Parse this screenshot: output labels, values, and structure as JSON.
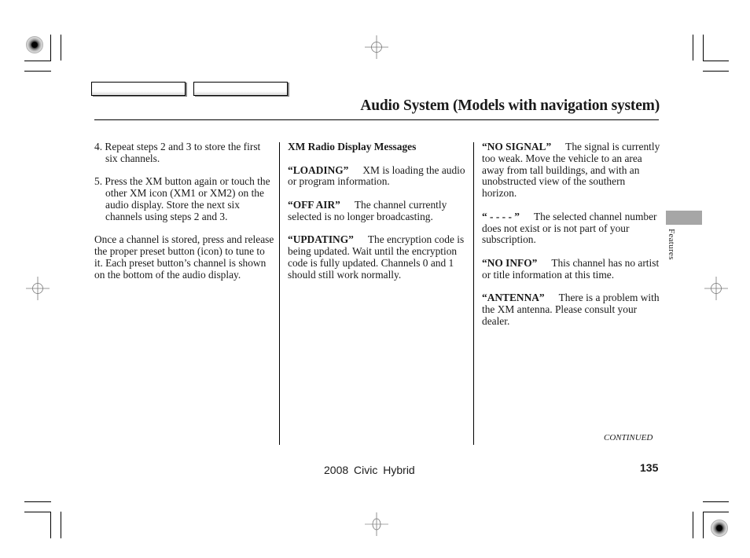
{
  "header": {
    "title": "Audio System (Models with navigation system)"
  },
  "columns": {
    "left": {
      "steps": [
        {
          "number": "4.",
          "text": "Repeat steps 2 and 3 to store the first six channels."
        },
        {
          "number": "5.",
          "text": "Press the XM button again or touch the other XM icon (XM1 or XM2) on the audio display. Store the next six channels using steps 2 and 3."
        }
      ],
      "paragraph": "Once a channel is stored, press and release the proper preset button (icon) to tune to it. Each preset button’s channel is shown on the bottom of the audio display."
    },
    "middle": {
      "heading": "XM Radio Display Messages",
      "messages": [
        {
          "term": "“LOADING”",
          "text": "XM is loading the audio or program information."
        },
        {
          "term": "“OFF AIR”",
          "text": "The channel currently selected is no longer broadcasting."
        },
        {
          "term": "“UPDATING”",
          "text": "The encryption code is being updated. Wait until the encryption code is fully updated. Channels 0 and 1 should still work normally."
        }
      ]
    },
    "right": {
      "messages": [
        {
          "term": "“NO SIGNAL”",
          "text": "The signal is currently too weak. Move the vehicle to an area away from tall buildings, and with an unobstructed view of the southern horizon."
        },
        {
          "term": "“ - - - - ”",
          "text": "The selected channel number does not exist or is not part of your subscription."
        },
        {
          "term": "“NO INFO”",
          "text": "This channel has no artist or title information at this time."
        },
        {
          "term": "“ANTENNA”",
          "text": "There is a problem with the XM antenna. Please consult your dealer."
        }
      ]
    }
  },
  "side_tab": {
    "label": "Features",
    "color": "#a6a6a6"
  },
  "continued_label": "CONTINUED",
  "footer": {
    "model": "2008  Civic  Hybrid",
    "page_number": "135"
  }
}
